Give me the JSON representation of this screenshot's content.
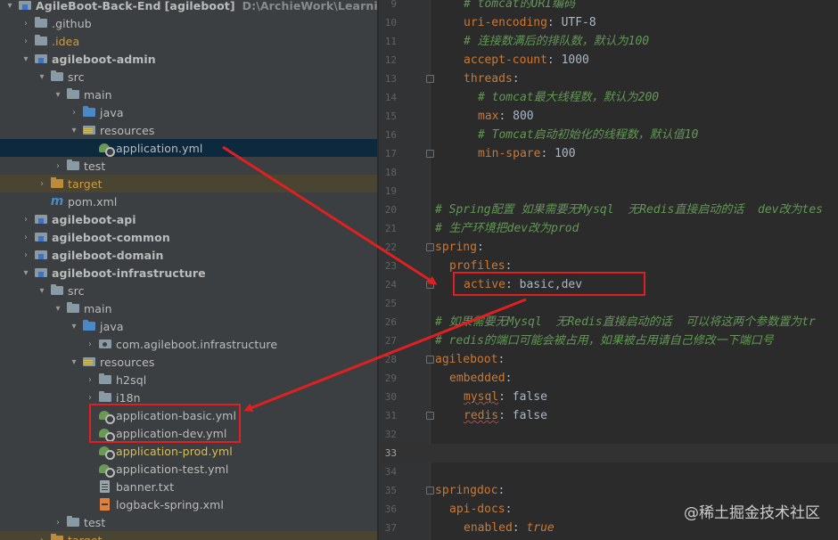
{
  "tree": {
    "project_name": "AgileBoot-Back-End",
    "project_module": "[agileboot]",
    "project_path": "D:\\ArchieWork\\Learning\\AgileBo",
    "items": [
      {
        "label": "AgileBoot-Back-End [agileboot]",
        "icon": "module-icon"
      },
      {
        "label": ".github",
        "icon": "folder-icon"
      },
      {
        "label": ".idea",
        "icon": "folder-icon"
      },
      {
        "label": "agileboot-admin",
        "icon": "module-icon"
      },
      {
        "label": "src",
        "icon": "folder-icon"
      },
      {
        "label": "main",
        "icon": "folder-icon"
      },
      {
        "label": "java",
        "icon": "java-source-folder-icon"
      },
      {
        "label": "resources",
        "icon": "resources-folder-icon"
      },
      {
        "label": "application.yml",
        "icon": "yaml-config-icon"
      },
      {
        "label": "test",
        "icon": "folder-icon"
      },
      {
        "label": "target",
        "icon": "excluded-folder-icon"
      },
      {
        "label": "pom.xml",
        "icon": "maven-icon"
      },
      {
        "label": "agileboot-api",
        "icon": "module-icon"
      },
      {
        "label": "agileboot-common",
        "icon": "module-icon"
      },
      {
        "label": "agileboot-domain",
        "icon": "module-icon"
      },
      {
        "label": "agileboot-infrastructure",
        "icon": "module-icon"
      },
      {
        "label": "src",
        "icon": "folder-icon"
      },
      {
        "label": "main",
        "icon": "folder-icon"
      },
      {
        "label": "java",
        "icon": "java-source-folder-icon"
      },
      {
        "label": "com.agileboot.infrastructure",
        "icon": "package-icon"
      },
      {
        "label": "resources",
        "icon": "resources-folder-icon"
      },
      {
        "label": "h2sql",
        "icon": "folder-icon"
      },
      {
        "label": "i18n",
        "icon": "folder-icon"
      },
      {
        "label": "application-basic.yml",
        "icon": "yaml-config-icon"
      },
      {
        "label": "application-dev.yml",
        "icon": "yaml-config-icon"
      },
      {
        "label": "application-prod.yml",
        "icon": "yaml-config-icon"
      },
      {
        "label": "application-test.yml",
        "icon": "yaml-config-icon"
      },
      {
        "label": "banner.txt",
        "icon": "text-file-icon"
      },
      {
        "label": "logback-spring.xml",
        "icon": "xml-file-icon"
      },
      {
        "label": "test",
        "icon": "folder-icon"
      },
      {
        "label": "target",
        "icon": "excluded-folder-icon"
      }
    ]
  },
  "editor": {
    "current_line": "33",
    "lines": [
      {
        "n": "9",
        "text": "# tomcat的URI编码"
      },
      {
        "n": "10",
        "key": "uri-encoding",
        "value": "UTF-8"
      },
      {
        "n": "11",
        "text": "# 连接数满后的排队数，默认为100"
      },
      {
        "n": "12",
        "key": "accept-count",
        "value": "1000"
      },
      {
        "n": "13",
        "key": "threads",
        "value": ""
      },
      {
        "n": "14",
        "text": "# tomcat最大线程数，默认为200"
      },
      {
        "n": "15",
        "key": "max",
        "value": "800"
      },
      {
        "n": "16",
        "text": "# Tomcat启动初始化的线程数，默认值10"
      },
      {
        "n": "17",
        "key": "min-spare",
        "value": "100"
      },
      {
        "n": "18"
      },
      {
        "n": "19"
      },
      {
        "n": "20",
        "text": "# Spring配置 如果需要无Mysql  无Redis直接启动的话  dev改为tes"
      },
      {
        "n": "21",
        "text": "# 生产环境把dev改为prod"
      },
      {
        "n": "22",
        "key": "spring",
        "value": ""
      },
      {
        "n": "23",
        "key": "profiles",
        "value": ""
      },
      {
        "n": "24",
        "key": "active",
        "value": "basic,dev"
      },
      {
        "n": "25"
      },
      {
        "n": "26",
        "text": "# 如果需要无Mysql  无Redis直接启动的话  可以将这两个参数置为tr"
      },
      {
        "n": "27",
        "text": "# redis的端口可能会被占用，如果被占用请自己修改一下端口号"
      },
      {
        "n": "28",
        "key": "agileboot",
        "value": ""
      },
      {
        "n": "29",
        "key": "embedded",
        "value": ""
      },
      {
        "n": "30",
        "key": "mysql",
        "value": "false"
      },
      {
        "n": "31",
        "key": "redis",
        "value": "false"
      },
      {
        "n": "32"
      },
      {
        "n": "33"
      },
      {
        "n": "34"
      },
      {
        "n": "35",
        "key": "springdoc",
        "value": ""
      },
      {
        "n": "36",
        "key": "api-docs",
        "value": ""
      },
      {
        "n": "37",
        "key": "enabled",
        "value": "true"
      }
    ]
  },
  "watermark": "@稀土掘金技术社区",
  "colors": {
    "annotation_red": "#e02020",
    "yaml_key": "#cc7832",
    "comment": "#629755",
    "selection": "#0d293e"
  }
}
